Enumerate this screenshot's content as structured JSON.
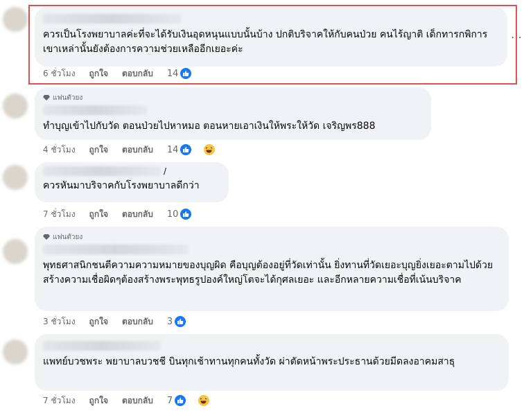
{
  "comments": [
    {
      "badge": "",
      "text": "ควรเป็นโรงพยาบาลค่ะที่จะได้รับเงินอุดหนุนแบบนั้นบ้าง ปกติบริจาคให้กับคนป่วย คนไร้ญาติ เด็กทารกพิการ เขาเหล่านั้นยังต้องการความช่วยเหลืออีกเยอะค่ะ",
      "time": "6 ชั่วโมง",
      "like": "ถูกใจ",
      "reply": "ตอบกลับ",
      "reactions": "14",
      "reaction_icons": [
        "like-icon"
      ]
    },
    {
      "badge": "แฟนตัวยง",
      "text": "ทำบุญเข้าไปกับวัด ตอนป่วยไปหาหมอ ตอนหายเอาเงินให้พระให้วัด เจริญพร888",
      "time": "4 ชั่วโมง",
      "like": "ถูกใจ",
      "reply": "ตอบกลับ",
      "reactions": "14",
      "reaction_icons": [
        "like-icon",
        "haha-icon"
      ]
    },
    {
      "badge": "",
      "name_tail": "/",
      "text": "ควรหันมาบริจาคกับโรงพยาบาลดีกว่า",
      "time": "7 ชั่วโมง",
      "like": "ถูกใจ",
      "reply": "ตอบกลับ",
      "reactions": "10",
      "reaction_icons": [
        "like-icon"
      ]
    },
    {
      "badge": "แฟนตัวยง",
      "text": "พุทธศาสนิกชนตีความความหมายของบุญผิด คือบุญต้องอยู่ที่วัดเท่านั้น ยิ่งทานที่วัดเยอะบุญยิ่งเยอะตามไปด้วย สร้างความเชื่อผิดๆต้องสร้างพระพุทธรูปองค์ใหญ่โตจะได้กุศลเยอะ และอีกหลายความเชื่อที่เน้นบริจาค",
      "time": "3 ชั่วโมง",
      "like": "ถูกใจ",
      "reply": "ตอบกลับ",
      "reactions": "3",
      "reaction_icons": [
        "like-icon"
      ]
    },
    {
      "badge": "",
      "text": "แพทย์บวชพระ พยาบาลบวชชี บินทุกเช้าทานทุกคนทั้งวัด ผ่าตัดหน้าพระประธานด้วยมีดลงอาคมสาธุ",
      "time": "7 ชั่วโมง",
      "like": "ถูกใจ",
      "reply": "ตอบกลับ",
      "reactions": "7",
      "reaction_icons": [
        "like-icon",
        "haha-icon"
      ]
    }
  ],
  "colors": {
    "highlight": "#e0504e",
    "like": "#1877f2",
    "haha": "#f7c544",
    "bubble": "#f0f2f5"
  }
}
